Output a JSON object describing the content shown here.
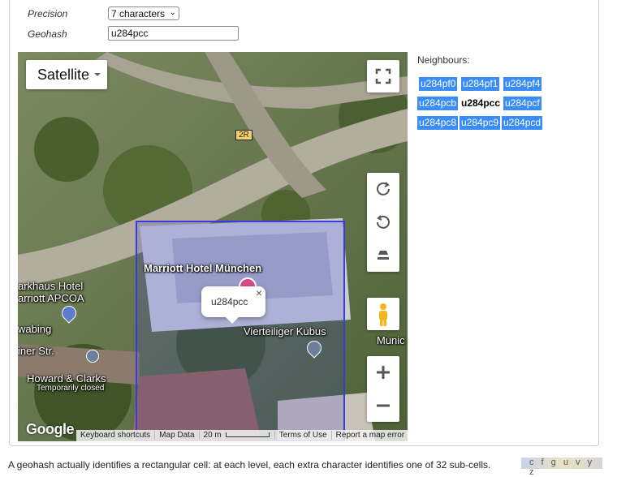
{
  "form": {
    "precision_label": "Precision",
    "precision_value": "7 characters",
    "geohash_label": "Geohash",
    "geohash_value": "u284pcc"
  },
  "map": {
    "map_type": "Satellite",
    "road_badge": "2R",
    "places": {
      "hotel": "Marriott Hotel München",
      "parkhaus_1": "arkhaus Hotel",
      "parkhaus_2": "arriott APCOA",
      "swabing": "wabing",
      "street": "iner Str.",
      "kubus": "Vierteiliger Kubus",
      "shop": "Howard & Clarks",
      "shop_status": "Temporarily closed",
      "munich": "Munic"
    },
    "popup_label": "u284pcc",
    "popup_close": "×",
    "logo": "Google",
    "attribution": {
      "shortcuts": "Keyboard shortcuts",
      "map_data": "Map Data",
      "scale": "20 m",
      "terms": "Terms of Use",
      "report": "Report a map error"
    }
  },
  "neighbours": {
    "title": "Neighbours:",
    "cells": [
      "u284pf0",
      "u284pf1",
      "u284pf4",
      "u284pcb",
      "u284pcc",
      "u284pcf",
      "u284pc8",
      "u284pc9",
      "u284pcd"
    ]
  },
  "footer": {
    "text": "A geohash actually identifies a rectangular cell: at each level, each extra character identifies one of 32 sub-cells.",
    "thumb": "c f g u v y z"
  },
  "colors": {
    "chip": "#3a8cf6",
    "cell_outline": "#3b3bdc"
  }
}
